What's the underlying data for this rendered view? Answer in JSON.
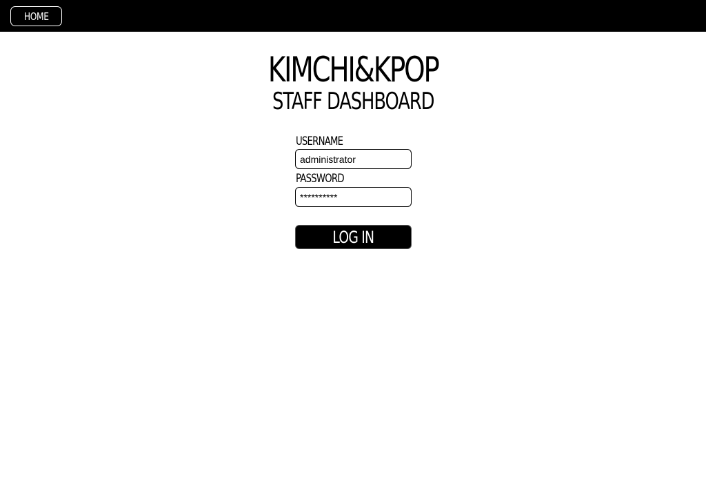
{
  "nav": {
    "home_label": "HOME"
  },
  "header": {
    "brand": "KIMCHI&KPOP",
    "subtitle": "STAFF DASHBOARD"
  },
  "login_form": {
    "username_label": "USERNAME",
    "username_value": "administrator",
    "password_label": "PASSWORD",
    "password_value": "**********",
    "submit_label": "LOG IN"
  },
  "colors": {
    "topbar": "#000000",
    "background": "#ffffff",
    "button": "#000000",
    "button_text": "#ffffff"
  }
}
